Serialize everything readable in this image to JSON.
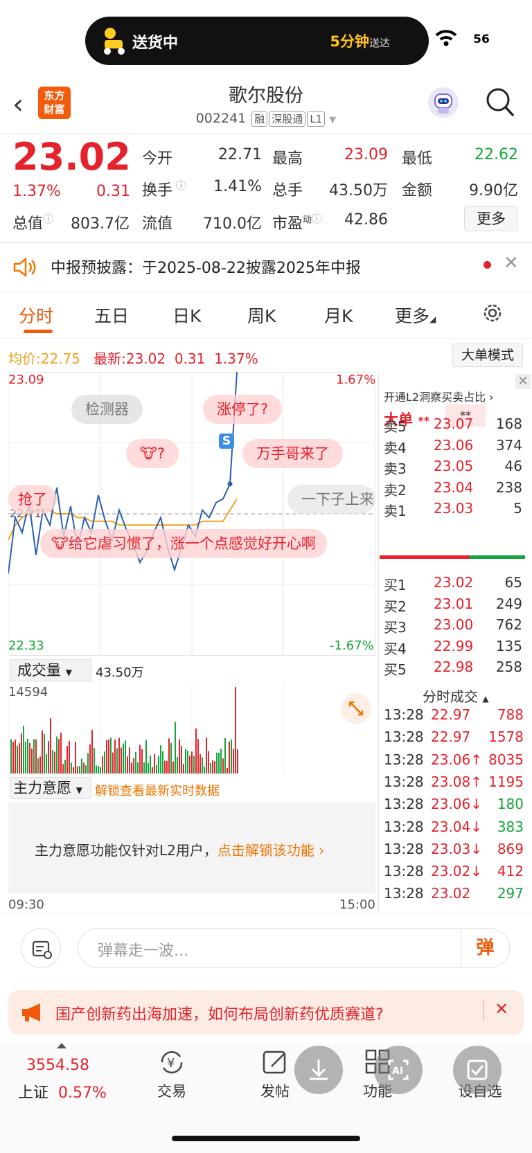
{
  "status": {
    "delivery": "送货中",
    "eta_num": "5分钟",
    "eta_suffix": "送达",
    "battery": "56"
  },
  "header": {
    "logo_line1": "东方",
    "logo_line2": "财富",
    "name": "歌尔股份",
    "code": "002241",
    "tags": [
      "融",
      "深股通",
      "L1"
    ]
  },
  "quote": {
    "price": "23.02",
    "pct": "1.37%",
    "chg": "0.31",
    "row1": [
      {
        "label": "今开",
        "value": "22.71",
        "color": "#333333"
      },
      {
        "label": "最高",
        "value": "23.09",
        "color": "#e5212b"
      },
      {
        "label": "最低",
        "value": "22.62",
        "color": "#12a53a"
      }
    ],
    "row2": [
      {
        "label": "换手",
        "value": "1.41%"
      },
      {
        "label": "总手",
        "value": "43.50万"
      },
      {
        "label": "金额",
        "value": "9.90亿"
      }
    ],
    "row3": [
      {
        "label": "总值",
        "value": "803.7亿"
      },
      {
        "label": "流值",
        "value": "710.0亿"
      },
      {
        "label": "市盈",
        "sup": "动",
        "value": "42.86"
      }
    ],
    "more": "更多"
  },
  "announce": {
    "text": "中报预披露：于2025-08-22披露2025年中报"
  },
  "tabs": [
    "分时",
    "五日",
    "日K",
    "周K",
    "月K",
    "更多"
  ],
  "info": {
    "avg_label": "均价:",
    "avg": "22.75",
    "last_label": "最新:",
    "last": "23.02",
    "chg": "0.31",
    "pct": "1.37%",
    "mode_btn": "大单模式"
  },
  "chart": {
    "hi": "23.09",
    "lo": "22.33",
    "hi_pct": "1.67%",
    "lo_pct": "-1.67%",
    "mid": "22.71",
    "time_start": "09:30",
    "time_end": "15:00"
  },
  "bubbles": {
    "b1": "检测器",
    "b2": "涨停了?",
    "b3": "?",
    "b4": "万手哥来了",
    "b5": "抢了",
    "b6": "一下子上来",
    "b7": "给它虐习惯了，涨一个点感觉好开心啊",
    "s_mark": "S"
  },
  "volume": {
    "label": "成交量",
    "total": "43.50万",
    "max": "14594"
  },
  "mainforce": {
    "label": "主力意愿",
    "unlock": "解锁查看最新实时数据",
    "msg": "主力意愿功能仅针对L2用户，",
    "link": "点击解锁该功能"
  },
  "orderbook": {
    "l2_hint": "开通L2洞察买卖占比",
    "big": "大单",
    "stars1": "**",
    "stars2": "**",
    "asks": [
      {
        "n": "卖5",
        "p": "23.07",
        "v": "168"
      },
      {
        "n": "卖4",
        "p": "23.06",
        "v": "374"
      },
      {
        "n": "卖3",
        "p": "23.05",
        "v": "46"
      },
      {
        "n": "卖2",
        "p": "23.04",
        "v": "238"
      },
      {
        "n": "卖1",
        "p": "23.03",
        "v": "5"
      }
    ],
    "bids": [
      {
        "n": "买1",
        "p": "23.02",
        "v": "65"
      },
      {
        "n": "买2",
        "p": "23.01",
        "v": "249"
      },
      {
        "n": "买3",
        "p": "23.00",
        "v": "762"
      },
      {
        "n": "买4",
        "p": "22.99",
        "v": "135"
      },
      {
        "n": "买5",
        "p": "22.98",
        "v": "258"
      }
    ],
    "trades_title": "分时成交",
    "trades": [
      {
        "t": "13:28",
        "p": "22.97",
        "v": "788",
        "vc": "#e5212b"
      },
      {
        "t": "13:28",
        "p": "22.97",
        "v": "1578",
        "vc": "#e5212b"
      },
      {
        "t": "13:28",
        "p": "23.06↑",
        "v": "8035",
        "vc": "#e5212b"
      },
      {
        "t": "13:28",
        "p": "23.08↑",
        "v": "1195",
        "vc": "#e5212b"
      },
      {
        "t": "13:28",
        "p": "23.06↓",
        "v": "180",
        "vc": "#12a53a"
      },
      {
        "t": "13:28",
        "p": "23.04↓",
        "v": "383",
        "vc": "#12a53a"
      },
      {
        "t": "13:28",
        "p": "23.03↓",
        "v": "869",
        "vc": "#e5212b"
      },
      {
        "t": "13:28",
        "p": "23.02↓",
        "v": "412",
        "vc": "#e5212b"
      },
      {
        "t": "13:28",
        "p": "23.02",
        "v": "297",
        "vc": "#12a53a"
      }
    ]
  },
  "danmu": {
    "placeholder": "弹幕走一波...",
    "send": "弹"
  },
  "ad": {
    "text": "国产创新药出海加速，如何布局创新药优质赛道?"
  },
  "nav": {
    "index_value": "3554.58",
    "index_name": "上证",
    "index_pct": "0.57%",
    "items": [
      "交易",
      "发帖",
      "功能",
      "设自选"
    ]
  },
  "chart_data": {
    "type": "line",
    "title": "",
    "x_range": [
      "09:30",
      "15:00"
    ],
    "ylim": [
      22.33,
      23.09
    ],
    "prev_close": 22.71,
    "series": [
      {
        "name": "最新",
        "values": [
          22.55,
          22.7,
          22.66,
          22.74,
          22.6,
          22.72,
          22.68,
          22.78,
          22.65,
          22.73,
          22.62,
          22.7,
          22.66,
          22.76,
          22.69,
          22.64,
          22.72,
          22.67,
          22.63,
          22.58,
          22.61,
          22.66,
          22.7,
          22.62,
          22.56,
          22.62,
          22.68,
          22.65,
          22.72,
          22.7,
          22.74,
          22.75,
          22.79,
          23.09
        ]
      },
      {
        "name": "均价",
        "values": [
          22.64,
          22.68,
          22.7,
          22.71,
          22.72,
          22.72,
          22.72,
          22.71,
          22.71,
          22.71,
          22.7,
          22.7,
          22.69,
          22.69,
          22.69,
          22.69,
          22.68,
          22.68,
          22.68,
          22.68,
          22.68,
          22.68,
          22.68,
          22.68,
          22.68,
          22.68,
          22.68,
          22.68,
          22.69,
          22.69,
          22.69,
          22.69,
          22.72,
          22.75
        ]
      }
    ]
  }
}
